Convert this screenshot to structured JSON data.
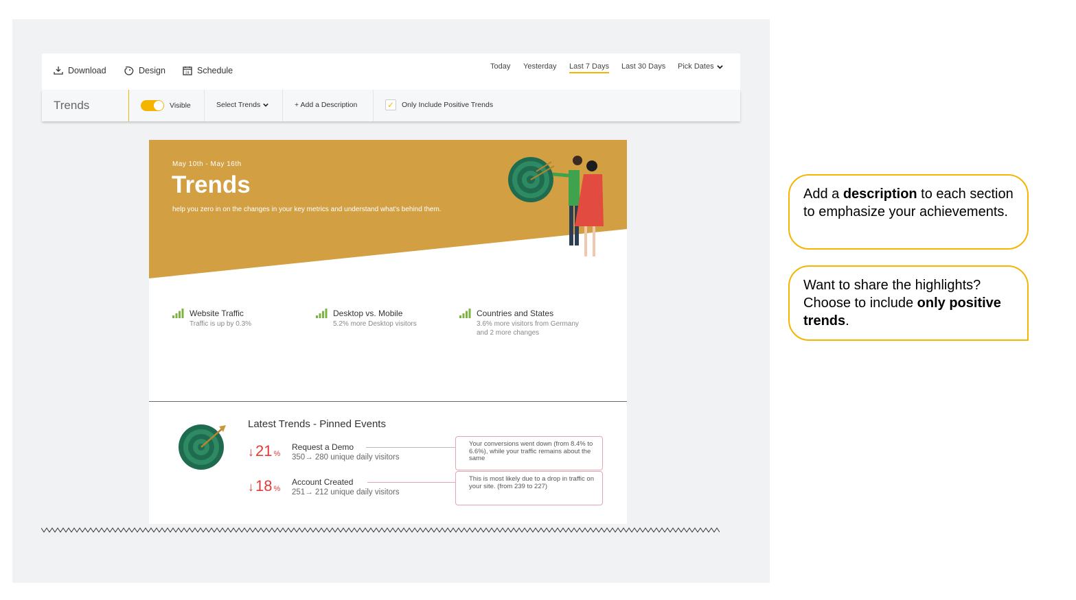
{
  "toolbar": {
    "download_label": "Download",
    "design_label": "Design",
    "schedule_label": "Schedule",
    "ranges": [
      "Today",
      "Yesterday",
      "Last 7 Days",
      "Last 30 Days",
      "Pick Dates"
    ],
    "active_range": "Last 7 Days"
  },
  "subbar": {
    "title": "Trends",
    "visible_label": "Visible",
    "visible_on": true,
    "select_trends_label": "Select Trends",
    "add_description_label": "+ Add a Description",
    "positive_only_label": "Only Include Positive Trends",
    "positive_only_checked": true
  },
  "report": {
    "date_range": "May 10th - May 16th",
    "title": "Trends",
    "subtitle": "help you zero in on the changes in your key metrics and understand what's behind them.",
    "metrics": [
      {
        "title": "Website Traffic",
        "desc1": "Traffic is up by 0.3%",
        "desc2": ""
      },
      {
        "title": "Desktop vs. Mobile",
        "desc1": "5.2% more Desktop visitors",
        "desc2": ""
      },
      {
        "title": "Countries and States",
        "desc1": "3.6% more visitors from Germany",
        "desc2": "and 2 more changes"
      }
    ],
    "pinned_title": "Latest Trends - Pinned Events",
    "events": [
      {
        "pct": "21",
        "unit": "%",
        "name": "Request a Demo",
        "from": "350",
        "to": "280",
        "suffix": "unique daily visitors",
        "note": "Your conversions went down (from 8.4% to 6.6%), while your traffic remains about the same"
      },
      {
        "pct": "18",
        "unit": "%",
        "name": "Account Created",
        "from": "251",
        "to": "212",
        "suffix": "unique daily visitors",
        "note": "This is most likely due to a drop in traffic on your site. (from 239 to 227)"
      }
    ]
  },
  "callouts": {
    "one": {
      "pre": "Add a ",
      "bold": "description",
      "post": " to each section to emphasize your achievements."
    },
    "two": {
      "pre": "Want to share the highlights? Choose to include ",
      "bold": "only positive trends",
      "post": "."
    }
  },
  "colors": {
    "accent": "#f5b400",
    "hero": "#d29f42",
    "down": "#e53935",
    "bars": "#7cb342"
  },
  "icons": [
    "download-icon",
    "design-icon",
    "calendar-icon",
    "chevron-down-icon",
    "check-icon",
    "signal-bars-icon",
    "target-icon",
    "arrow-down-icon"
  ]
}
